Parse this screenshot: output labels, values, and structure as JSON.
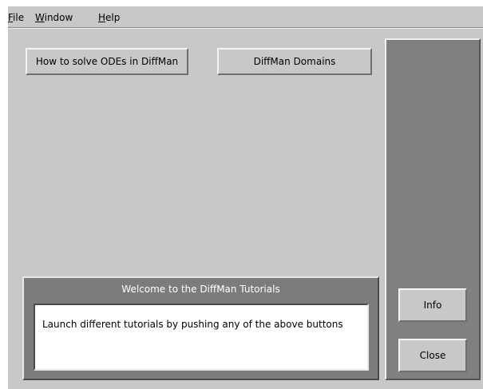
{
  "menubar": {
    "file": {
      "mnemonic": "F",
      "rest": "ile"
    },
    "window": {
      "mnemonic": "W",
      "rest": "indow"
    },
    "help": {
      "mnemonic": "H",
      "rest": "elp"
    }
  },
  "main": {
    "buttons": [
      {
        "label": "How to solve ODEs in DiffMan"
      },
      {
        "label": "DiffMan Domains"
      }
    ]
  },
  "welcome": {
    "title": "Welcome to the DiffMan Tutorials",
    "message": "Launch different tutorials by pushing any of the above buttons"
  },
  "side": {
    "info_label": "Info",
    "close_label": "Close"
  }
}
